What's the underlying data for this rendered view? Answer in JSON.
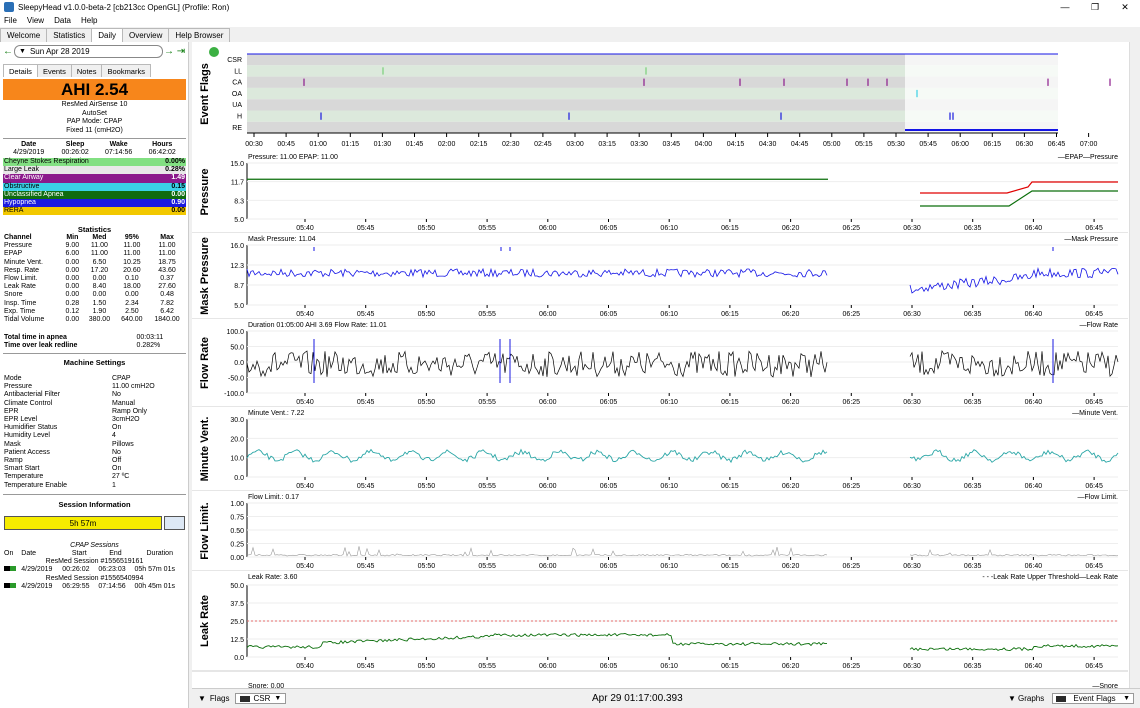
{
  "window": {
    "title": "SleepyHead v1.0.0-beta-2 [cb213cc OpenGL] (Profile: Ron)",
    "minimize": "—",
    "maximize": "❐",
    "close": "✕"
  },
  "menu": [
    "File",
    "View",
    "Data",
    "Help"
  ],
  "tabs": [
    "Welcome",
    "Statistics",
    "Daily",
    "Overview",
    "Help Browser"
  ],
  "date": {
    "prev": "←",
    "value": "Sun Apr 28 2019",
    "next": "→",
    "last": "⇥"
  },
  "subtabs": [
    "Details",
    "Events",
    "Notes",
    "Bookmarks"
  ],
  "ahi": "AHI 2.54",
  "machine": [
    "ResMed AirSense 10",
    "AutoSet",
    "PAP Mode: CPAP",
    "Fixed 11 (cmH2O)"
  ],
  "sleep_header": [
    "Date",
    "Sleep",
    "Wake",
    "Hours"
  ],
  "sleep_values": [
    "4/29/2019",
    "00:26:02",
    "07:14:56",
    "06:42:02"
  ],
  "events": [
    {
      "name": "Cheyne Stokes Respiration",
      "value": "0.00%",
      "bg": "#82e082",
      "fg": "#000000"
    },
    {
      "name": "Large Leak",
      "value": "0.28%",
      "bg": "#e8e8e8",
      "fg": "#000000"
    },
    {
      "name": "Clear Airway",
      "value": "1.49",
      "bg": "#8b1a8b",
      "fg": "#ffffff"
    },
    {
      "name": "Obstructive",
      "value": "0.15",
      "bg": "#3ad0e6",
      "fg": "#000000"
    },
    {
      "name": "Unclassified Apnea",
      "value": "0.00",
      "bg": "#0f6b0f",
      "fg": "#ffffff"
    },
    {
      "name": "Hypopnea",
      "value": "0.90",
      "bg": "#1a1ae0",
      "fg": "#ffffff"
    },
    {
      "name": "RERA",
      "value": "0.00",
      "bg": "#f2c800",
      "fg": "#000000"
    }
  ],
  "stats_title": "Statistics",
  "stats_header": [
    "Channel",
    "Min",
    "Med",
    "95%",
    "Max"
  ],
  "stats": [
    [
      "Pressure",
      "9.00",
      "11.00",
      "11.00",
      "11.00"
    ],
    [
      "EPAP",
      "6.00",
      "11.00",
      "11.00",
      "11.00"
    ],
    [
      "Minute Vent.",
      "0.00",
      "6.50",
      "10.25",
      "18.75"
    ],
    [
      "Resp. Rate",
      "0.00",
      "17.20",
      "20.60",
      "43.60"
    ],
    [
      "Flow Limit.",
      "0.00",
      "0.00",
      "0.10",
      "0.37"
    ],
    [
      "Leak Rate",
      "0.00",
      "8.40",
      "18.00",
      "27.60"
    ],
    [
      "Snore",
      "0.00",
      "0.00",
      "0.00",
      "0.48"
    ],
    [
      "Insp. Time",
      "0.28",
      "1.50",
      "2.34",
      "7.82"
    ],
    [
      "Exp. Time",
      "0.12",
      "1.90",
      "2.50",
      "6.42"
    ],
    [
      "Tidal Volume",
      "0.00",
      "380.00",
      "640.00",
      "1840.00"
    ]
  ],
  "apnea_time": {
    "label": "Total time in apnea",
    "value": "00:03:11"
  },
  "leak_redline": {
    "label": "Time over leak redline",
    "value": "0.282%"
  },
  "settings_title": "Machine Settings",
  "settings": [
    [
      "Mode",
      "CPAP"
    ],
    [
      "Pressure",
      "11.00 cmH2O"
    ],
    [
      "Antibacterial Filter",
      "No"
    ],
    [
      "Climate Control",
      "Manual"
    ],
    [
      "EPR",
      "Ramp Only"
    ],
    [
      "EPR Level",
      "3cmH2O"
    ],
    [
      "Humidifier Status",
      "On"
    ],
    [
      "Humidity Level",
      "4"
    ],
    [
      "Mask",
      "Pillows"
    ],
    [
      "Patient Access",
      "No"
    ],
    [
      "Ramp",
      "Off"
    ],
    [
      "Smart Start",
      "On"
    ],
    [
      "Temperature",
      "27 ºC"
    ],
    [
      "Temperature Enable",
      "1"
    ]
  ],
  "session_title": "Session Information",
  "session_bar": "5h 57m",
  "cpap_sessions_title": "CPAP Sessions",
  "sessions_header": [
    "On",
    "Date",
    "Start",
    "End",
    "Duration"
  ],
  "sessions": [
    {
      "name": "ResMed Session #1556519161",
      "date": "4/29/2019",
      "start": "00:26:02",
      "end": "06:23:03",
      "dur": "05h 57m 01s"
    },
    {
      "name": "ResMed Session #1556540994",
      "date": "4/29/2019",
      "start": "06:29:55",
      "end": "07:14:56",
      "dur": "00h 45m 01s"
    }
  ],
  "event_flags": {
    "label": "Event Flags",
    "rows": [
      "CSR",
      "LL",
      "CA",
      "OA",
      "UA",
      "H",
      "RE"
    ],
    "ticks": [
      "00:30",
      "00:45",
      "01:00",
      "01:15",
      "01:30",
      "01:45",
      "02:00",
      "02:15",
      "02:30",
      "02:45",
      "03:00",
      "03:15",
      "03:30",
      "03:45",
      "04:00",
      "04:15",
      "04:30",
      "04:45",
      "05:00",
      "05:15",
      "05:30",
      "05:45",
      "06:00",
      "06:15",
      "06:30",
      "06:45",
      "07:00"
    ]
  },
  "time_ticks": [
    "05:40",
    "05:45",
    "05:50",
    "05:55",
    "06:00",
    "06:05",
    "06:10",
    "06:15",
    "06:20",
    "06:25",
    "06:30",
    "06:35",
    "06:40",
    "06:45"
  ],
  "panels": [
    {
      "label": "Pressure",
      "header": "Pressure: 11.00 EPAP: 11.00",
      "legend": "—EPAP—Pressure",
      "yticks": [
        "15.0",
        "11.7",
        "8.3",
        "5.0"
      ]
    },
    {
      "label": "Mask Pressure",
      "header": "Mask Pressure: 11.04",
      "legend": "—Mask Pressure",
      "yticks": [
        "16.0",
        "12.3",
        "8.7",
        "5.0"
      ]
    },
    {
      "label": "Flow Rate",
      "header": "Duration 01:05:00 AHI 3.69 Flow Rate: 11.01",
      "legend": "—Flow Rate",
      "yticks": [
        "100.0",
        "50.0",
        "0.0",
        "-50.0",
        "-100.0"
      ]
    },
    {
      "label": "Minute Vent.",
      "header": "Minute Vent.: 7.22",
      "legend": "—Minute Vent.",
      "yticks": [
        "30.0",
        "20.0",
        "10.0",
        "0.0"
      ]
    },
    {
      "label": "Flow Limit.",
      "header": "Flow Limit.: 0.17",
      "legend": "—Flow Limit.",
      "yticks": [
        "1.00",
        "0.75",
        "0.50",
        "0.25",
        "0.00"
      ]
    },
    {
      "label": "Leak Rate",
      "header": "Leak Rate: 3.60",
      "legend": "- - -Leak Rate Upper Threshold—Leak Rate",
      "yticks": [
        "50.0",
        "37.5",
        "25.0",
        "12.5",
        "0.0"
      ]
    }
  ],
  "snore": {
    "header": "Snore: 0.00",
    "legend": "—Snore"
  },
  "bottom": {
    "flags": "Flags",
    "csr": "CSR",
    "timestamp": "Apr 29 01:17:00.393",
    "graphs": "Graphs",
    "event_flags": "Event Flags"
  },
  "colors": {
    "ahi": "#f7861b",
    "pressure": "#0a6e0a",
    "epap": "#e00000",
    "mask": "#1414e6",
    "flow": "#000000",
    "minvent": "#2aa6a6",
    "flowlim": "#9a9a9a",
    "leak": "#0a6e0a",
    "threshold": "#e04040"
  }
}
